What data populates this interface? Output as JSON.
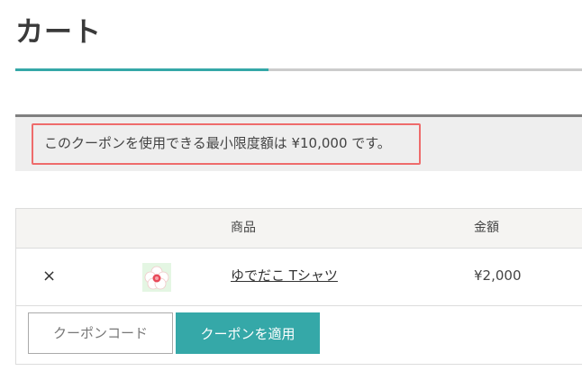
{
  "page": {
    "title": "カート"
  },
  "notice": {
    "message": "このクーポンを使用できる最小限度額は ¥10,000 です。"
  },
  "cart": {
    "headers": {
      "product": "商品",
      "price": "金額"
    },
    "items": [
      {
        "remove_label": "×",
        "thumbnail_icon": "flower-icon",
        "name": "ゆでだこ Tシャツ",
        "price": "¥2,000"
      }
    ]
  },
  "coupon": {
    "placeholder": "クーポンコード",
    "apply_label": "クーポンを適用"
  },
  "colors": {
    "accent": "#35a8a8",
    "notice_border": "#ee6b6b"
  }
}
